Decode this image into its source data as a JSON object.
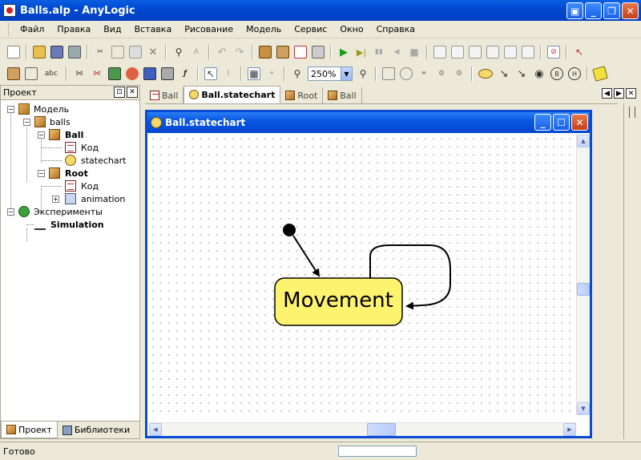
{
  "window": {
    "title": "Balls.alp - AnyLogic"
  },
  "menu": [
    "Файл",
    "Правка",
    "Вид",
    "Вставка",
    "Рисование",
    "Модель",
    "Сервис",
    "Окно",
    "Справка"
  ],
  "toolbar": {
    "zoom": "250%"
  },
  "project_panel": {
    "title": "Проект",
    "tree": {
      "model": "Модель",
      "balls": "balls",
      "ball": "Ball",
      "ball_code": "Код",
      "ball_statechart": "statechart",
      "root": "Root",
      "root_code": "Код",
      "root_animation": "animation",
      "experiments": "Эксперименты",
      "simulation": "Simulation"
    },
    "tabs": [
      "Проект",
      "Библиотеки"
    ]
  },
  "editor": {
    "tabs": [
      "Ball",
      "Ball.statechart",
      "Root",
      "Ball"
    ],
    "active_tab": 1,
    "window_title": "Ball.statechart",
    "state_label": "Movement"
  },
  "status": {
    "text": "Готово"
  },
  "colors": {
    "state_fill": "#fef36f",
    "titlebar": "#0a4bd6"
  }
}
